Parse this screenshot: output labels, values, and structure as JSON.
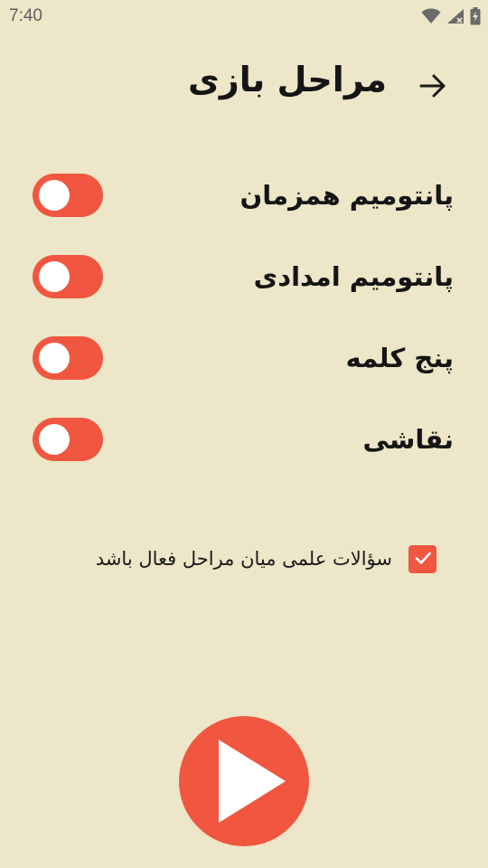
{
  "status_bar": {
    "time": "7:40",
    "icons": [
      "wifi-icon",
      "signal-icon",
      "battery-charging-icon"
    ]
  },
  "header": {
    "title": "مراحل بازی",
    "back_icon": "arrow-right-icon"
  },
  "stages": [
    {
      "label": "پانتومیم همزمان",
      "enabled": false
    },
    {
      "label": "پانتومیم امدادی",
      "enabled": false
    },
    {
      "label": "پنج کلمه",
      "enabled": false
    },
    {
      "label": "نقاشی",
      "enabled": false
    }
  ],
  "science_option": {
    "label": "سؤالات علمی میان مراحل فعال باشد",
    "checked": true
  },
  "play": {
    "icon": "play-icon"
  },
  "colors": {
    "background": "#EDE6C8",
    "accent": "#F05640",
    "knob": "#FFFFFF",
    "text": "#151515"
  }
}
